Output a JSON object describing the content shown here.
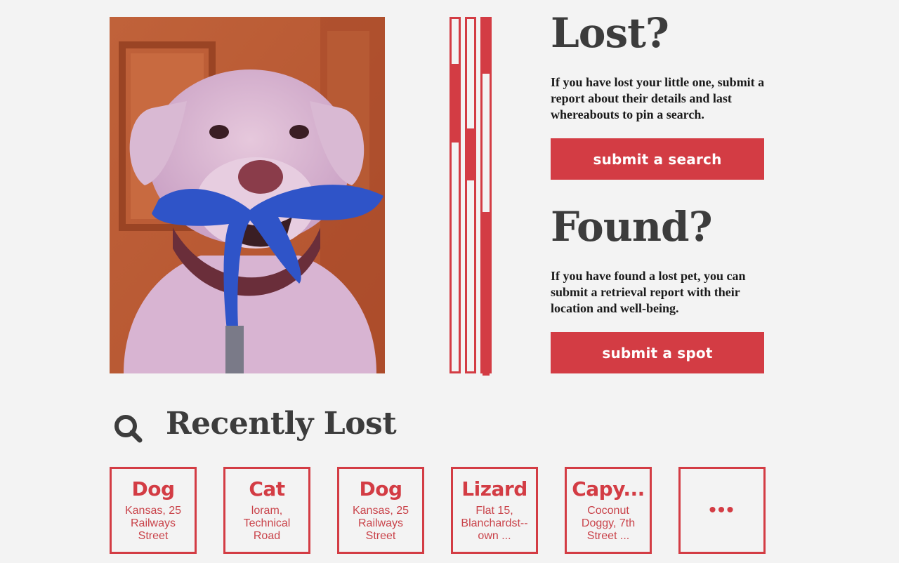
{
  "photo": {
    "alt": "dog holding leash"
  },
  "lost": {
    "heading": "Lost?",
    "text": "If you have lost your little one, submit a report about their details and last whereabouts to pin a search.",
    "button": "submit a search"
  },
  "found": {
    "heading": "Found?",
    "text": "If you have found a lost pet, you can submit a retrieval report with their location and well-being.",
    "button": "submit a spot"
  },
  "recent": {
    "icon": "search-icon",
    "title": "Recently Lost",
    "cards": [
      {
        "kind": "Dog",
        "location": "Kansas, 25 Railways Street"
      },
      {
        "kind": "Cat",
        "location": "loram, Technical Road"
      },
      {
        "kind": "Dog",
        "location": "Kansas, 25 Railways Street"
      },
      {
        "kind": "Lizard",
        "location": "Flat 15, Blanchardst--own ..."
      },
      {
        "kind": "Capy...",
        "location": "Coconut Doggy, 7th Street ..."
      }
    ],
    "more": "•••"
  },
  "colors": {
    "accent": "#d33c44",
    "heading": "#3c3c3c",
    "background": "#f3f3f3"
  }
}
